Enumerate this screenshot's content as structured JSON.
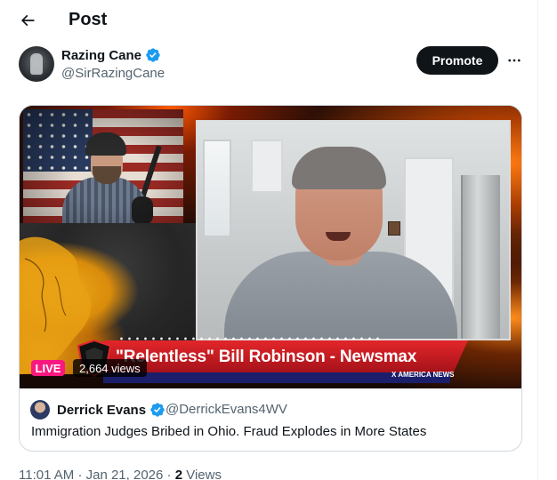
{
  "header": {
    "title": "Post",
    "back_icon": "arrow-left-icon"
  },
  "author": {
    "name": "Razing Cane",
    "handle": "@SirRazingCane",
    "verified": true,
    "verified_color": "#1d9bf0"
  },
  "actions": {
    "promote_label": "Promote",
    "more_icon": "ellipsis-icon"
  },
  "video": {
    "live_label": "LIVE",
    "views_label": "2,664 views",
    "banner_text": "\"Relentless\"  Bill Robinson  -  Newsmax",
    "network_tag": "X AMERICA NEWS",
    "live_color": "#f91880"
  },
  "quote": {
    "name": "Derrick Evans",
    "handle": "@DerrickEvans4WV",
    "verified": true,
    "text": "Immigration Judges Bribed in Ohio. Fraud Explodes in More States"
  },
  "meta": {
    "time": "11:01 AM",
    "separator": "·",
    "date": "Jan 21, 2026",
    "views_count": "2",
    "views_label": "Views"
  },
  "colors": {
    "text_primary": "#0f1419",
    "text_secondary": "#536471",
    "border": "#cfd9de",
    "button_dark": "#0f1419"
  }
}
